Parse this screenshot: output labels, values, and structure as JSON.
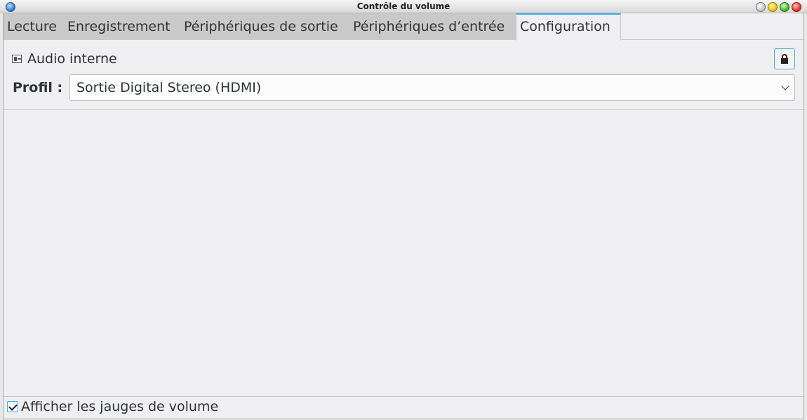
{
  "window": {
    "title": "Contrôle du volume"
  },
  "tabs": [
    {
      "label": "Lecture",
      "active": false
    },
    {
      "label": "Enregistrement",
      "active": false
    },
    {
      "label": "Périphériques de sortie",
      "active": false
    },
    {
      "label": "Périphériques d’entrée",
      "active": false
    },
    {
      "label": "Configuration",
      "active": true
    }
  ],
  "card": {
    "device_name": "Audio interne",
    "device_icon": "audio-card-icon",
    "lock_icon": "lock-icon",
    "profile_label": "Profil :",
    "profile_value": "Sortie Digital Stereo (HDMI)"
  },
  "footer": {
    "show_meters_label": "Afficher les jauges de volume",
    "show_meters_checked": true
  },
  "colors": {
    "accent": "#3daee9",
    "background": "#efeff1",
    "inactive_tab": "#c9c9c9"
  }
}
